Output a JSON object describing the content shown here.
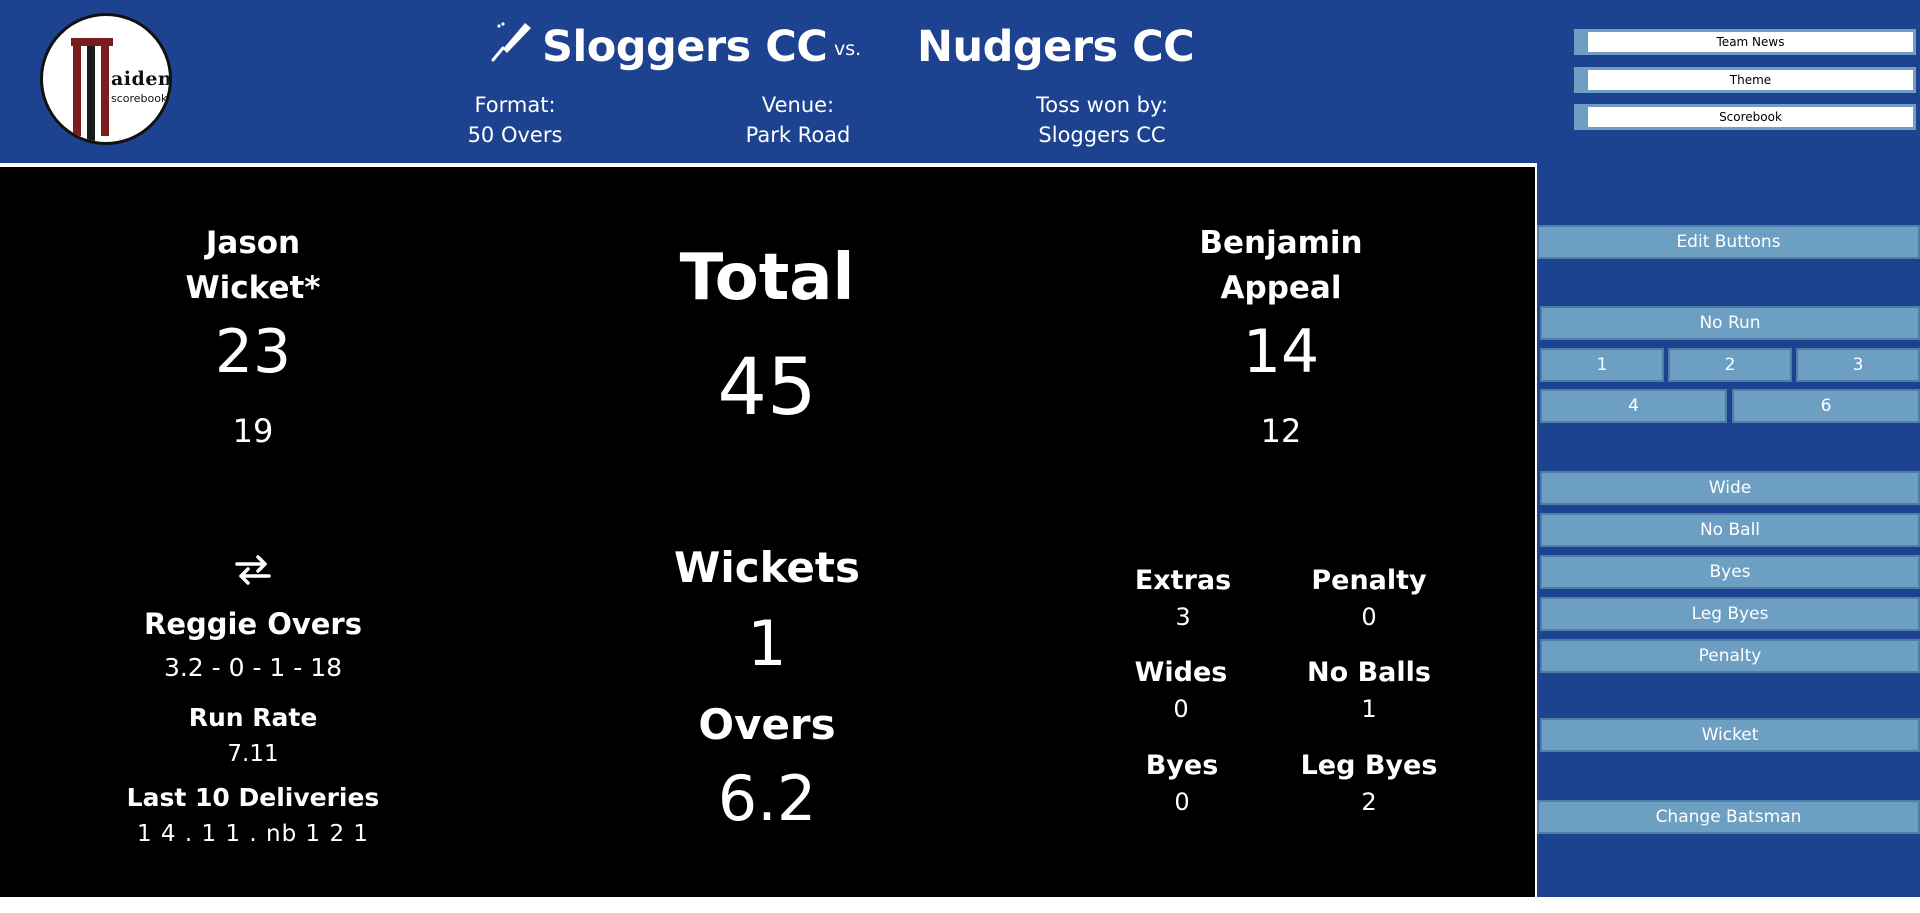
{
  "logo": {
    "wordmark": "aiden.",
    "sub": "scorebook"
  },
  "match": {
    "home_team": "Sloggers CC",
    "vs": "vs.",
    "away_team": "Nudgers CC",
    "format_label": "Format:",
    "format_value": "50 Overs",
    "venue_label": "Venue:",
    "venue_value": "Park Road",
    "toss_label": "Toss won by:",
    "toss_value": "Sloggers CC"
  },
  "header_buttons": [
    "Team News",
    "Theme",
    "Scorebook"
  ],
  "batsmen": {
    "striker": {
      "first": "Jason",
      "last": "Wicket*",
      "runs": "23",
      "balls": "19"
    },
    "non_striker": {
      "first": "Benjamin",
      "last": "Appeal",
      "runs": "14",
      "balls": "12"
    }
  },
  "bowler": {
    "swap_icon": "swap-arrows-icon",
    "name": "Reggie Overs",
    "figures": "3.2 - 0 - 1 - 18",
    "run_rate_label": "Run Rate",
    "run_rate": "7.11",
    "last10_label": "Last 10 Deliveries",
    "last10": "1 4 . 1 1 . nb 1 2 1"
  },
  "innings": {
    "total_label": "Total",
    "total": "45",
    "wickets_label": "Wickets",
    "wickets": "1",
    "overs_label": "Overs",
    "overs": "6.2"
  },
  "extras": {
    "extras_label": "Extras",
    "extras": "3",
    "penalty_label": "Penalty",
    "penalty": "0",
    "wides_label": "Wides",
    "wides": "0",
    "noballs_label": "No Balls",
    "noballs": "1",
    "byes_label": "Byes",
    "byes": "0",
    "legbyes_label": "Leg Byes",
    "legbyes": "2"
  },
  "panel": {
    "edit": "Edit Buttons",
    "no_run": "No Run",
    "run1": "1",
    "run2": "2",
    "run3": "3",
    "run4": "4",
    "run6": "6",
    "wide": "Wide",
    "no_ball": "No Ball",
    "byes": "Byes",
    "leg_byes": "Leg Byes",
    "penalty": "Penalty",
    "wicket": "Wicket",
    "change_batsman": "Change Batsman"
  },
  "colors": {
    "header_bg": "#1c4290",
    "button_bg": "#6d9fc2",
    "board_bg": "#000000",
    "logo_red": "#7a1d1d"
  }
}
